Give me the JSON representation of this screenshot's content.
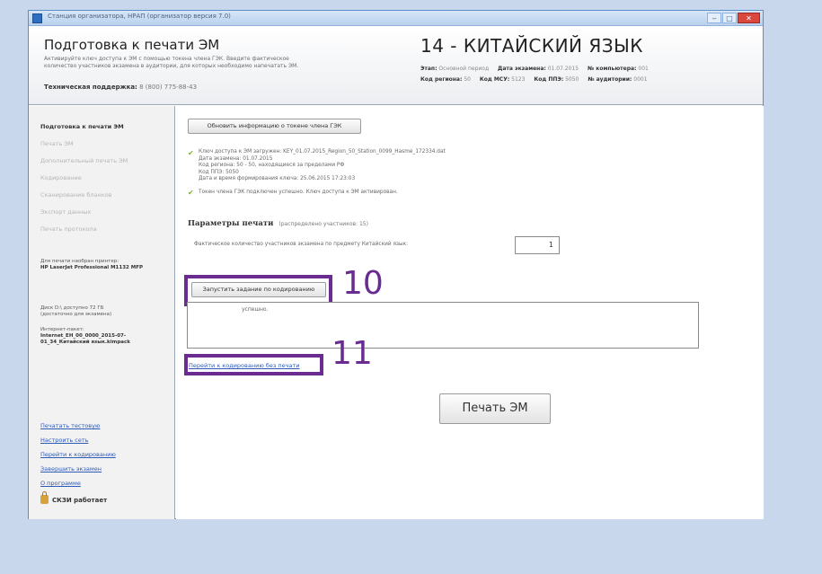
{
  "window": {
    "title": "Станция организатора, НРАП (организатор версия 7.0)"
  },
  "header": {
    "title": "Подготовка к печати ЭМ",
    "description": "Активируйте ключ доступа к ЭМ с помощью токена члена ГЭК. Введите фактическое количество участников экзамена в аудитории, для которых необходимо напечатать ЭМ.",
    "support_label": "Техническая поддержка:",
    "support_phone": "8 (800) 775-88-43",
    "subject": "14 - КИТАЙСКИЙ ЯЗЫК",
    "meta_row1": [
      {
        "label": "Этап:",
        "value": "Основной период"
      },
      {
        "label": "Дата экзамена:",
        "value": "01.07.2015"
      },
      {
        "label": "№ компьютера:",
        "value": "001"
      }
    ],
    "meta_row2": [
      {
        "label": "Код региона:",
        "value": "50"
      },
      {
        "label": "Код МСУ:",
        "value": "5123"
      },
      {
        "label": "Код ППЭ:",
        "value": "5050"
      },
      {
        "label": "№ аудитории:",
        "value": "0001"
      }
    ]
  },
  "sidebar": {
    "nav": [
      {
        "label": "Подготовка к печати ЭМ",
        "active": true
      },
      {
        "label": "Печать ЭМ",
        "active": false
      },
      {
        "label": "Дополнительный печать ЭМ",
        "active": false
      },
      {
        "label": "Кодирование",
        "active": false
      },
      {
        "label": "Сканирование бланков",
        "active": false
      },
      {
        "label": "Экспорт данных",
        "active": false
      },
      {
        "label": "Печать протокола",
        "active": false
      }
    ],
    "printer_label": "Для печати наобран принтер:",
    "printer_name": "HP LaserJet Professional M1132 MFP",
    "disk_label": "Диск D:\\ доступно 72 ГБ",
    "disk_sub": "(достаточно для экзамена)",
    "package_label": "Интернет-пакет:",
    "package_name": "Internet_EH_00_0000_2015-07-01_34_Китайский язык.kimpack",
    "links": [
      "Печатать тестовую",
      "Настроить сеть",
      "Перейти к кодированию",
      "Завершить экзамен",
      "О программе"
    ],
    "status": "СКЗИ работает"
  },
  "main": {
    "refresh_button": "Обновить информацию о токене члена ГЭК",
    "key_info": [
      "Ключ доступа к ЭМ загружен: KEY_01.07.2015_Region_50_Station_0099_Hasme_172334.dat",
      "Дата экзамена: 01.07.2015",
      "Код региона: 50 - 50, находящиеся за пределами РФ",
      "Код ППЭ: 5050",
      "Дата и время формирования ключа: 25.06.2015 17:23:03"
    ],
    "token_info": "Токен члена ГЭК подключен успешно. Ключ доступа к ЭМ активирован.",
    "params_title": "Параметры печати",
    "params_note": "(распределено участников: 15)",
    "qty_label": "Фактическое количество участников экзамена по предмету Китайский язык:",
    "qty_value": "1",
    "start_button": "Запустить задание по кодированию",
    "log_text": "успешно.",
    "link_noprint": "Перейти к кодированию без печати",
    "print_button": "Печать ЭМ"
  },
  "annotations": {
    "a10": "10",
    "a11": "11",
    "color": "#6a2c91"
  }
}
